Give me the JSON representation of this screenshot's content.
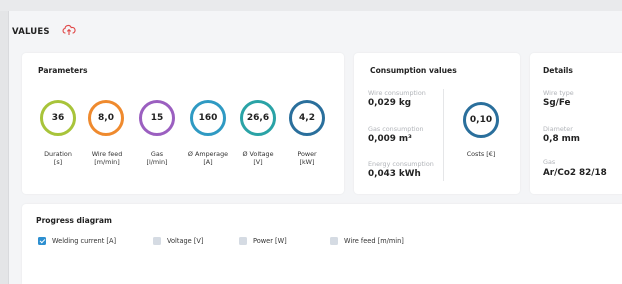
{
  "header": {
    "title": "VALUES"
  },
  "parameters": {
    "title": "Parameters",
    "gauges": [
      {
        "value": "36",
        "label": "Duration\n[s]",
        "color": "#a8c43a"
      },
      {
        "value": "8,0",
        "label": "Wire feed\n[m/min]",
        "color": "#ef8a2e"
      },
      {
        "value": "15",
        "label": "Gas\n[l/min]",
        "color": "#9b5fc0"
      },
      {
        "value": "160",
        "label": "Ø Amperage\n[A]",
        "color": "#2f9ac3"
      },
      {
        "value": "26,6",
        "label": "Ø Voltage\n[V]",
        "color": "#2aa3a6"
      },
      {
        "value": "4,2",
        "label": "Power\n[kW]",
        "color": "#2a6f9c"
      }
    ]
  },
  "consumption": {
    "title": "Consumption values",
    "items": [
      {
        "label": "Wire consumption",
        "value": "0,029 kg"
      },
      {
        "label": "Gas consumption",
        "value": "0,009 m³"
      },
      {
        "label": "Energy consumption",
        "value": "0,043 kWh"
      }
    ],
    "costs": {
      "value": "0,10",
      "label": "Costs [€]",
      "color": "#2a6f9c"
    }
  },
  "details": {
    "title": "Details",
    "items": [
      {
        "label": "Wire type",
        "value": "Sg/Fe"
      },
      {
        "label": "Diameter",
        "value": "0,8 mm"
      },
      {
        "label": "Gas",
        "value": "Ar/Co2 82/18"
      }
    ]
  },
  "progress": {
    "title": "Progress diagram",
    "options": [
      {
        "label": "Welding current [A]",
        "checked": true
      },
      {
        "label": "Voltage [V]",
        "checked": false
      },
      {
        "label": "Power [W]",
        "checked": false
      },
      {
        "label": "Wire feed [m/min]",
        "checked": false
      }
    ]
  },
  "colors": {
    "accent": "#2d8fd0",
    "cloud_icon": "#e04848"
  }
}
